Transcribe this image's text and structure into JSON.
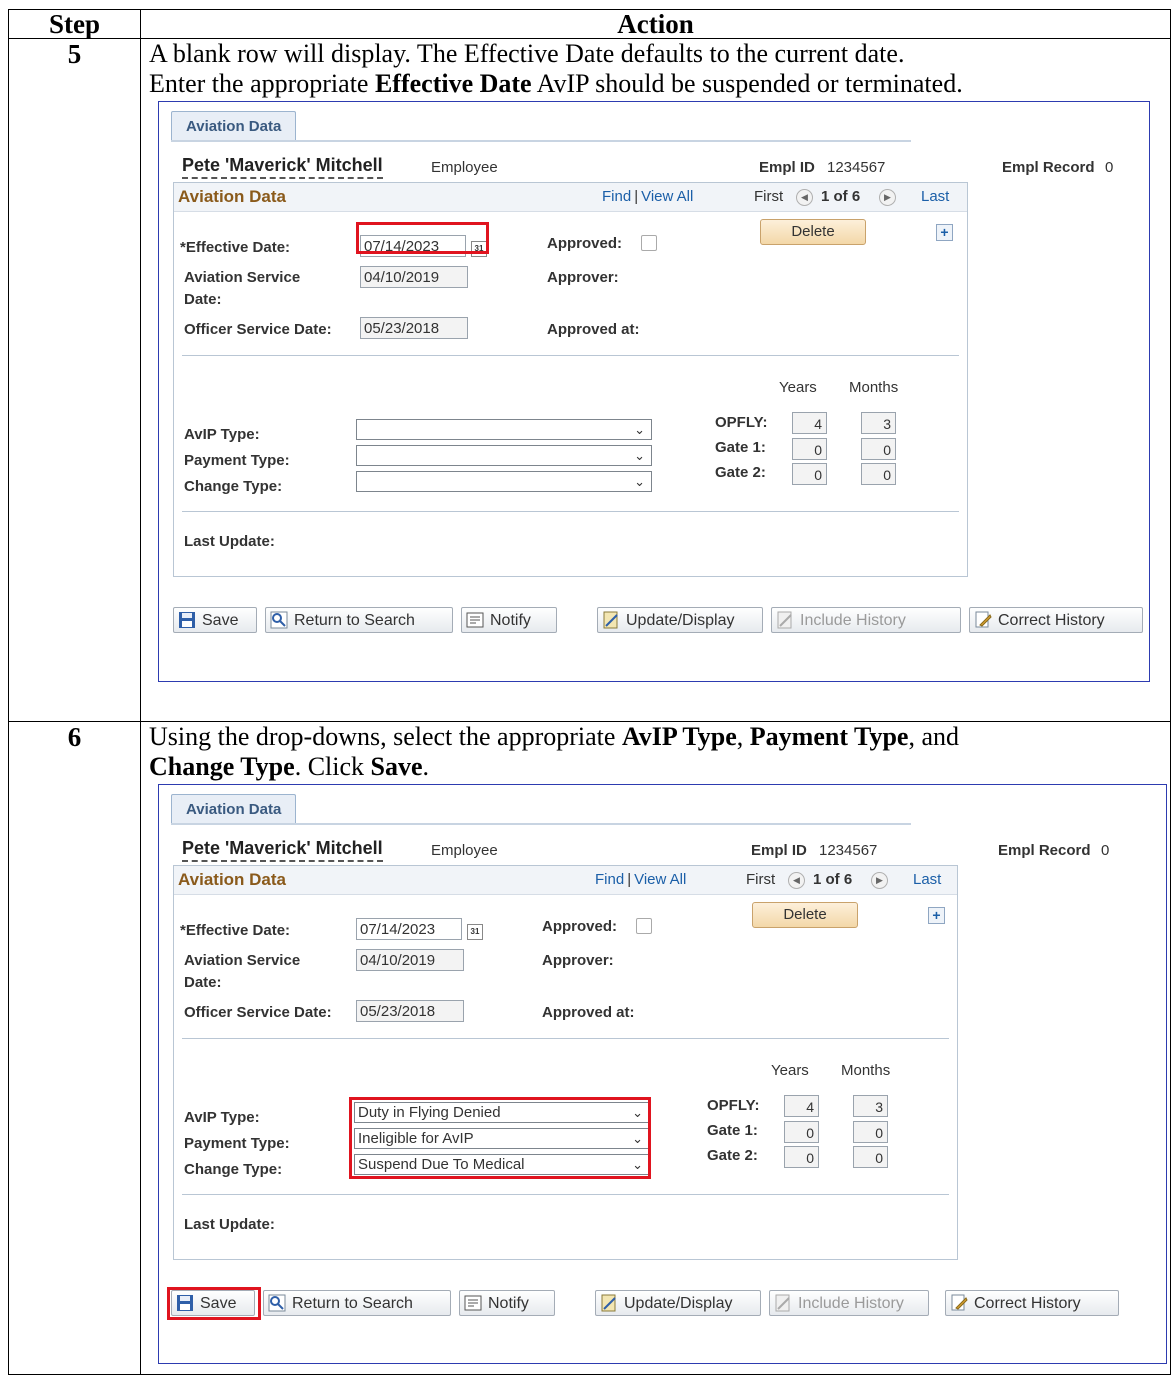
{
  "table": {
    "header_step": "Step",
    "header_action": "Action"
  },
  "steps": [
    {
      "number": "5",
      "instruction_line1": "A blank row will display. The Effective Date defaults to the current date.",
      "instruction_line2_pre": "Enter the appropriate ",
      "instruction_line2_bold": "Effective Date",
      "instruction_line2_post": " AvIP should be suspended or terminated."
    },
    {
      "number": "6",
      "instruction_line1_pre": "Using the drop-downs, select the appropriate ",
      "instruction_line1_bold1": "AvIP Type",
      "instruction_line1_sep1": ", ",
      "instruction_line1_bold2": "Payment Type",
      "instruction_line1_sep2": ", and",
      "instruction_line2_bold1": "Change Type",
      "instruction_line2_mid": ". Click ",
      "instruction_line2_bold2": "Save",
      "instruction_line2_post": "."
    }
  ],
  "screens": [
    {
      "tab": "Aviation Data",
      "employee_name": "Pete 'Maverick' Mitchell",
      "employee_role": "Employee",
      "empl_id_label": "Empl ID",
      "empl_id": "1234567",
      "empl_record_label": "Empl Record",
      "empl_record": "0",
      "panel_title": "Aviation Data",
      "find": "Find",
      "link_sep": "|",
      "view_all": "View All",
      "first": "First",
      "count": "1 of 6",
      "last": "Last",
      "delete": "Delete",
      "effective_date_label": "*Effective Date:",
      "effective_date": "07/14/2023",
      "aviation_service_label_1": "Aviation Service",
      "aviation_service_label_2": "Date:",
      "aviation_service_date": "04/10/2019",
      "officer_service_label": "Officer Service Date:",
      "officer_service_date": "05/23/2018",
      "approved_label": "Approved:",
      "approver_label": "Approver:",
      "approved_at_label": "Approved at:",
      "years_label": "Years",
      "months_label": "Months",
      "avip_type_label": "AvIP Type:",
      "payment_type_label": "Payment Type:",
      "change_type_label": "Change Type:",
      "avip_type": "",
      "payment_type": "",
      "change_type": "",
      "opfly_label": "OPFLY:",
      "gate1_label": "Gate 1:",
      "gate2_label": "Gate 2:",
      "opfly_years": "4",
      "opfly_months": "3",
      "gate1_years": "0",
      "gate1_months": "0",
      "gate2_years": "0",
      "gate2_months": "0",
      "last_update_label": "Last Update:",
      "btn_save": "Save",
      "btn_return": "Return to Search",
      "btn_notify": "Notify",
      "btn_update": "Update/Display",
      "btn_history": "Include History",
      "btn_correct": "Correct History"
    },
    {
      "tab": "Aviation Data",
      "employee_name": "Pete 'Maverick' Mitchell",
      "employee_role": "Employee",
      "empl_id_label": "Empl ID",
      "empl_id": "1234567",
      "empl_record_label": "Empl Record",
      "empl_record": "0",
      "panel_title": "Aviation Data",
      "find": "Find",
      "link_sep": "|",
      "view_all": "View All",
      "first": "First",
      "count": "1 of 6",
      "last": "Last",
      "delete": "Delete",
      "effective_date_label": "*Effective Date:",
      "effective_date": "07/14/2023",
      "aviation_service_label_1": "Aviation Service",
      "aviation_service_label_2": "Date:",
      "aviation_service_date": "04/10/2019",
      "officer_service_label": "Officer Service Date:",
      "officer_service_date": "05/23/2018",
      "approved_label": "Approved:",
      "approver_label": "Approver:",
      "approved_at_label": "Approved at:",
      "years_label": "Years",
      "months_label": "Months",
      "avip_type_label": "AvIP Type:",
      "payment_type_label": "Payment Type:",
      "change_type_label": "Change Type:",
      "avip_type": "Duty in Flying Denied",
      "payment_type": "Ineligible for AvIP",
      "change_type": "Suspend Due To Medical",
      "opfly_label": "OPFLY:",
      "gate1_label": "Gate 1:",
      "gate2_label": "Gate 2:",
      "opfly_years": "4",
      "opfly_months": "3",
      "gate1_years": "0",
      "gate1_months": "0",
      "gate2_years": "0",
      "gate2_months": "0",
      "last_update_label": "Last Update:",
      "btn_save": "Save",
      "btn_return": "Return to Search",
      "btn_notify": "Notify",
      "btn_update": "Update/Display",
      "btn_history": "Include History",
      "btn_correct": "Correct History"
    }
  ],
  "colors": {
    "highlight": "#e0141f",
    "frame": "#2d3bb0",
    "panel_title": "#8a5a1b",
    "link": "#1b5fa8"
  }
}
